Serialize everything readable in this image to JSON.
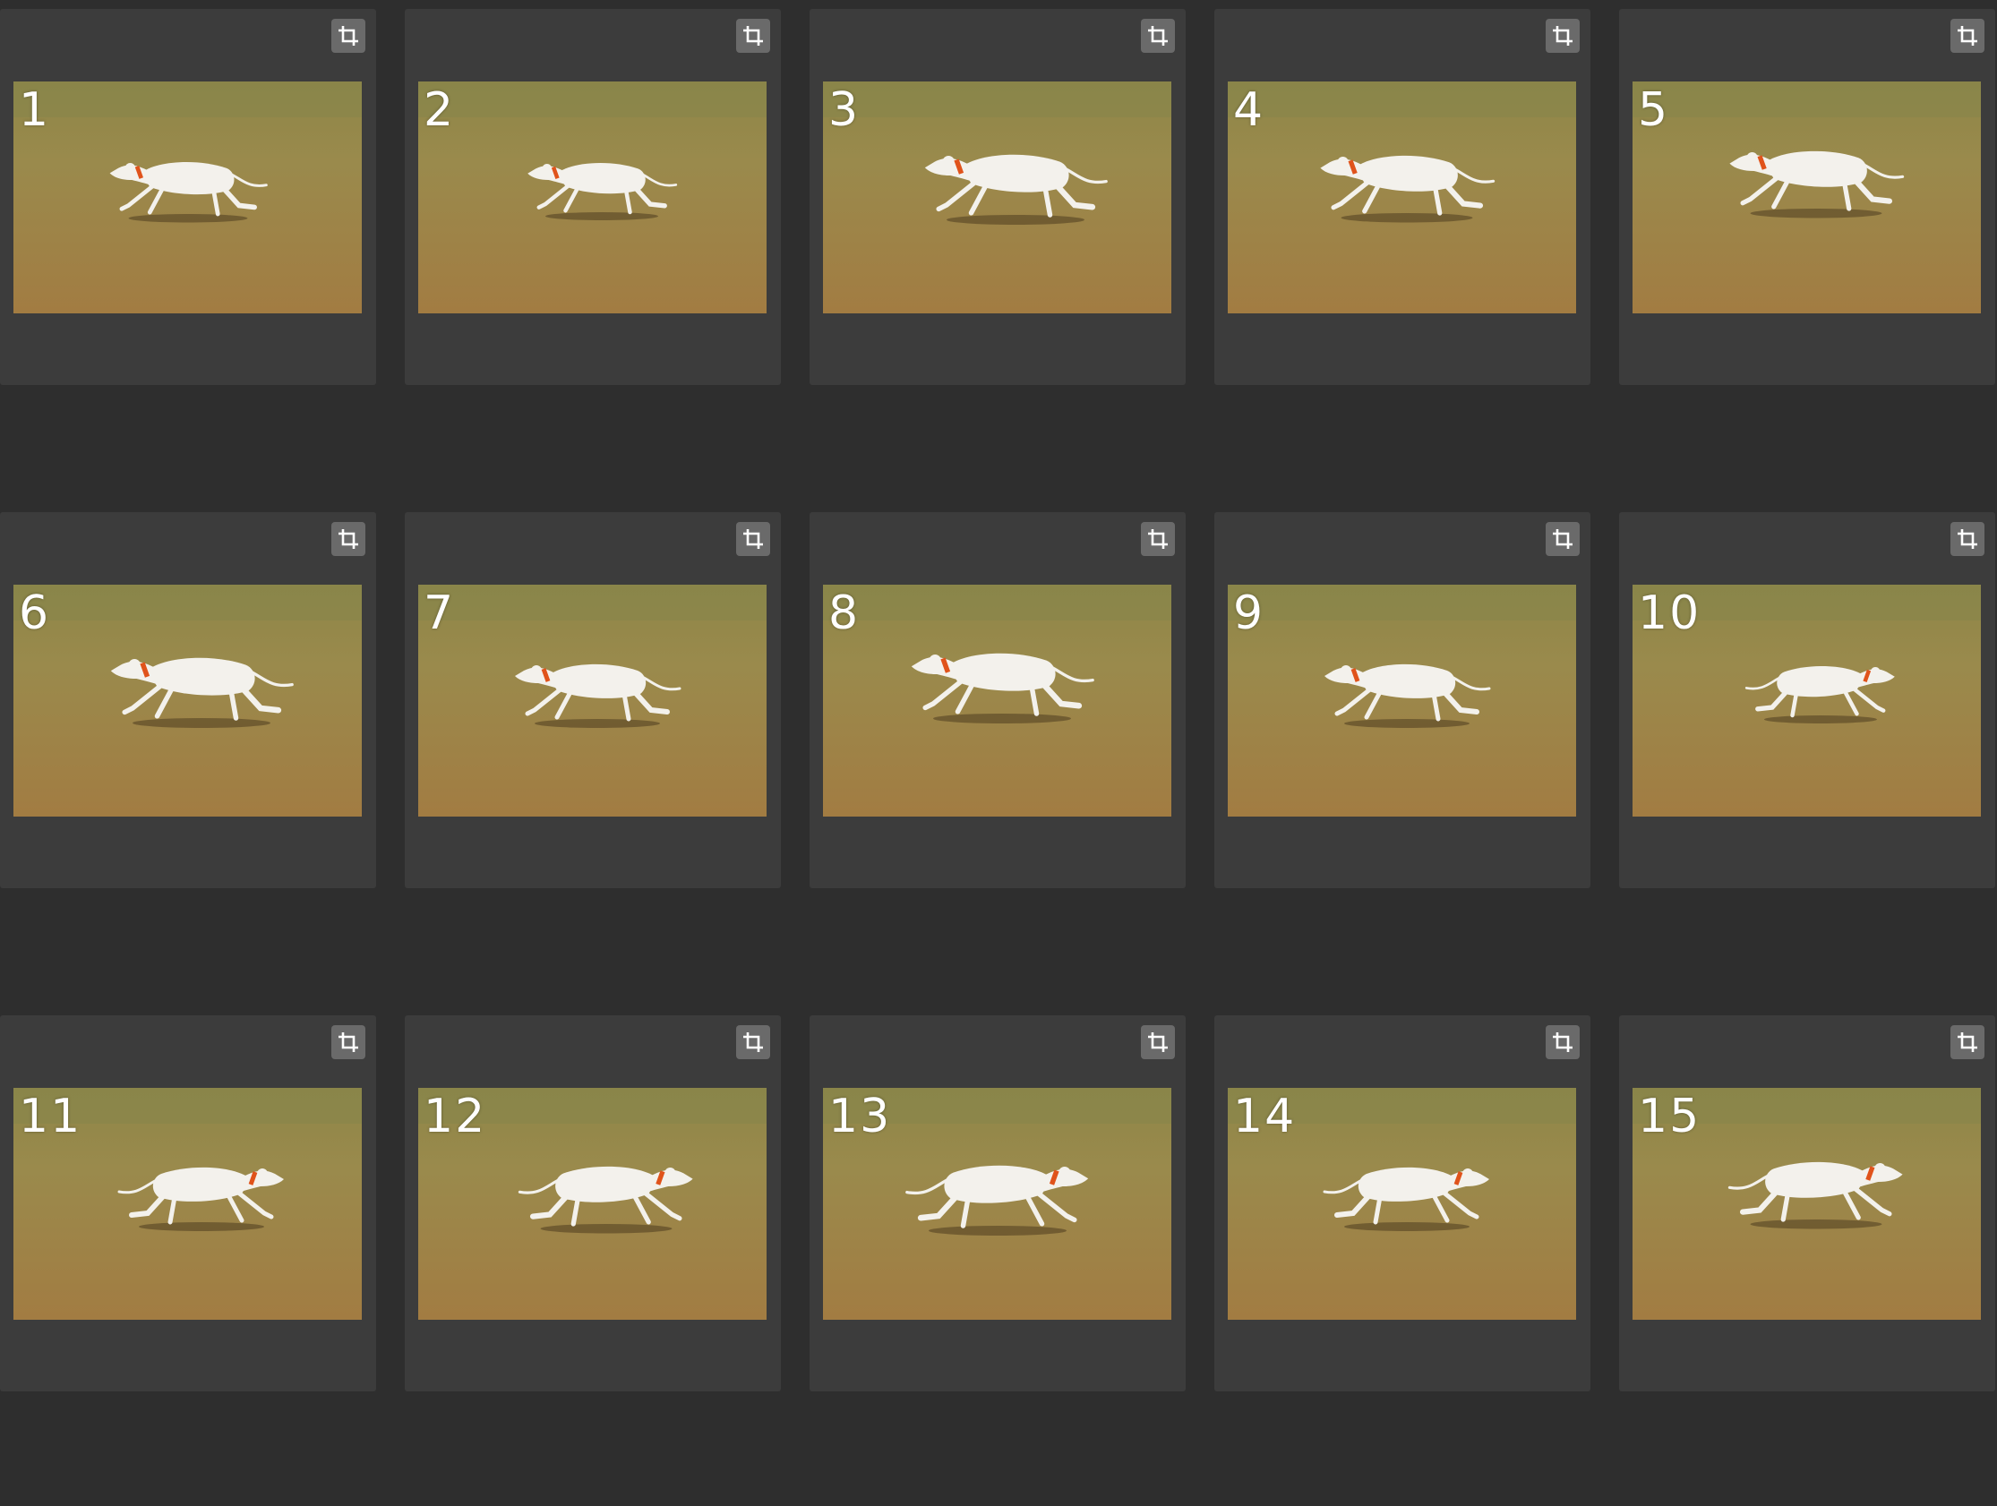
{
  "colors": {
    "app_background": "#2e2e2e",
    "cell_background": "#3c3c3c",
    "crop_button": "#6a6a6a",
    "grass": "#98854a",
    "dog": "#f3f1ec",
    "collar": "#e0531b"
  },
  "icons": {
    "crop": "crop-icon"
  },
  "frames": [
    {
      "label": "1"
    },
    {
      "label": "2"
    },
    {
      "label": "3"
    },
    {
      "label": "4"
    },
    {
      "label": "5"
    },
    {
      "label": "6"
    },
    {
      "label": "7"
    },
    {
      "label": "8"
    },
    {
      "label": "9"
    },
    {
      "label": "10"
    },
    {
      "label": "11"
    },
    {
      "label": "12"
    },
    {
      "label": "13"
    },
    {
      "label": "14"
    },
    {
      "label": "15"
    }
  ]
}
